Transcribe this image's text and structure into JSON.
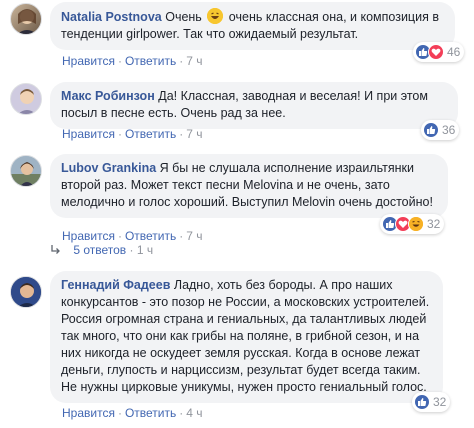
{
  "comments": [
    {
      "author": "Natalia Postnova",
      "text_before_emoji": "Очень",
      "text_after_emoji": "очень классная она, и композиция в тенденции girlpower. Так что ожидаемый результат.",
      "actions": {
        "like": "Нравится",
        "reply": "Ответить",
        "time": "7 ч"
      },
      "reactions": {
        "types": [
          "like",
          "love"
        ],
        "count": "46"
      }
    },
    {
      "author": "Макс Робинзон",
      "text": "Да! Классная, заводная и веселая! И при этом посыл в песне есть. Очень рад за нее.",
      "actions": {
        "like": "Нравится",
        "reply": "Ответить",
        "time": "7 ч"
      },
      "reactions": {
        "types": [
          "like"
        ],
        "count": "36"
      }
    },
    {
      "author": "Lubov Grankina",
      "text": "Я бы не слушала исполнение израильтянки второй раз. Может текст песни Melovina и не очень, зато мелодично и голос хороший. Выступил Melovin очень достойно!",
      "actions": {
        "like": "Нравится",
        "reply": "Ответить",
        "time": "7 ч"
      },
      "reactions": {
        "types": [
          "like",
          "love",
          "haha"
        ],
        "count": "32"
      },
      "replies": {
        "label": "5 ответов",
        "time": "1 ч"
      }
    },
    {
      "author": "Геннадий Фадеев",
      "text": "Ладно, хоть без бороды. А про наших конкурсантов - это позор не России, а московских устроителей. Россия огромная страна и гениальных, да талантливых людей так много, что они как грибы на поляне, в грибной сезон, и на них никогда не оскудеет земля русская. Когда в основе лежат деньги, глупость и нарциссизм, результат будет всегда таким. Не нужны цирковые уникумы, нужен просто гениальный голос.",
      "actions": {
        "like": "Нравится",
        "reply": "Ответить",
        "time": "4 ч"
      },
      "reactions": {
        "types": [
          "like"
        ],
        "count": "32"
      }
    }
  ],
  "colors": {
    "link": "#385898",
    "bubble": "#f2f3f5",
    "meta": "#90949c",
    "action": "#4267b2"
  },
  "icons": {
    "like": "thumbs-up-icon",
    "love": "heart-icon",
    "haha": "laughing-face-icon",
    "reply_arrow": "reply-arrow-icon"
  }
}
